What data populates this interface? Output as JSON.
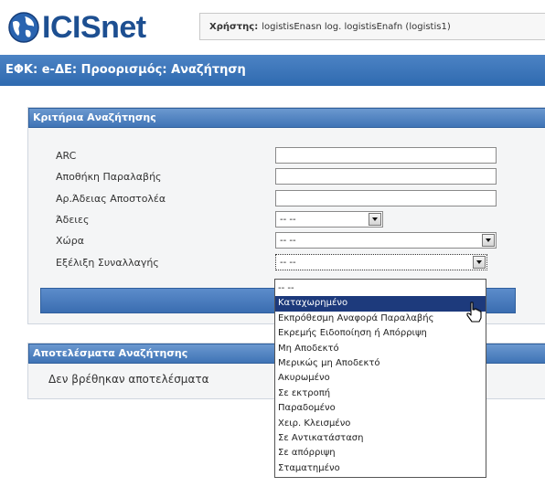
{
  "brand": {
    "name": "ICISnet"
  },
  "user": {
    "label": "Χρήστης:",
    "value": "logistisEnasn log. logistisEnafn (logistis1)"
  },
  "page_title": "ΕΦΚ: e-ΔΕ: Προορισμός: Αναζήτηση",
  "criteria": {
    "title": "Κριτήρια Αναζήτησης",
    "fields": [
      {
        "label": "ARC",
        "type": "text",
        "value": ""
      },
      {
        "label": "Αποθήκη Παραλαβής",
        "type": "text",
        "value": ""
      },
      {
        "label": "Αρ.Άδειας Αποστολέα",
        "type": "text",
        "value": ""
      },
      {
        "label": "Άδειες",
        "type": "select",
        "value": "-- --"
      },
      {
        "label": "Χώρα",
        "type": "select",
        "value": "-- --"
      },
      {
        "label": "Εξέλιξη Συναλλαγής",
        "type": "select",
        "value": "-- --"
      }
    ]
  },
  "results": {
    "title": "Αποτελέσματα Αναζήτησης",
    "empty_text": "Δεν βρέθηκαν αποτελέσματα"
  },
  "dropdown": {
    "selected_index": 1,
    "options": [
      "-- --",
      "Καταχωρημένο",
      "Εκπρόθεσμη Αναφορά Παραλαβής",
      "Εκρεμής Ειδοποίηση ή Απόρριψη",
      "Μη Αποδεκτό",
      "Μερικώς μη Αποδεκτό",
      "Ακυρωμένο",
      "Σε εκτροπή",
      "Παραδομένο",
      "Χειρ. Κλεισμένο",
      "Σε Αντικατάσταση",
      "Σε απόρριψη",
      "Σταματημένο"
    ]
  },
  "colors": {
    "brand": "#1d4f91",
    "header": "#3a6db1",
    "selected": "#1d3a7c"
  }
}
